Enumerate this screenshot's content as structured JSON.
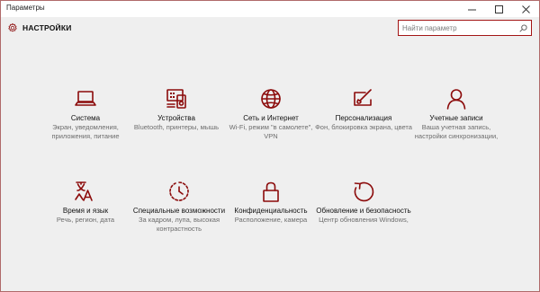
{
  "window": {
    "title": "Параметры",
    "controls": {
      "minimize": "—",
      "maximize": "☐",
      "close": "✕"
    }
  },
  "header": {
    "title": "НАСТРОЙКИ",
    "search_placeholder": "Найти параметр"
  },
  "colors": {
    "accent": "#8b0a0a",
    "search_border": "#a31515"
  },
  "tiles": [
    {
      "icon": "laptop-icon",
      "name": "Система",
      "desc": "Экран, уведомления, приложения, питание"
    },
    {
      "icon": "devices-icon",
      "name": "Устройства",
      "desc": "Bluetooth, принтеры, мышь"
    },
    {
      "icon": "globe-icon",
      "name": "Сеть и Интернет",
      "desc": "Wi-Fi, режим \"в самолете\", VPN"
    },
    {
      "icon": "paint-icon",
      "name": "Персонализация",
      "desc": "Фон, блокировка экрана, цвета"
    },
    {
      "icon": "person-icon",
      "name": "Учетные записи",
      "desc": "Ваша учетная запись, настройки синхронизации,"
    },
    {
      "icon": "language-icon",
      "name": "Время и язык",
      "desc": "Речь, регион, дата"
    },
    {
      "icon": "accessibility-icon",
      "name": "Специальные возможности",
      "desc": "За кадром, лупа, высокая контрастность"
    },
    {
      "icon": "lock-icon",
      "name": "Конфиденциальность",
      "desc": "Расположение, камера"
    },
    {
      "icon": "update-icon",
      "name": "Обновление и безопасность",
      "desc": "Центр обновления Windows,"
    }
  ]
}
